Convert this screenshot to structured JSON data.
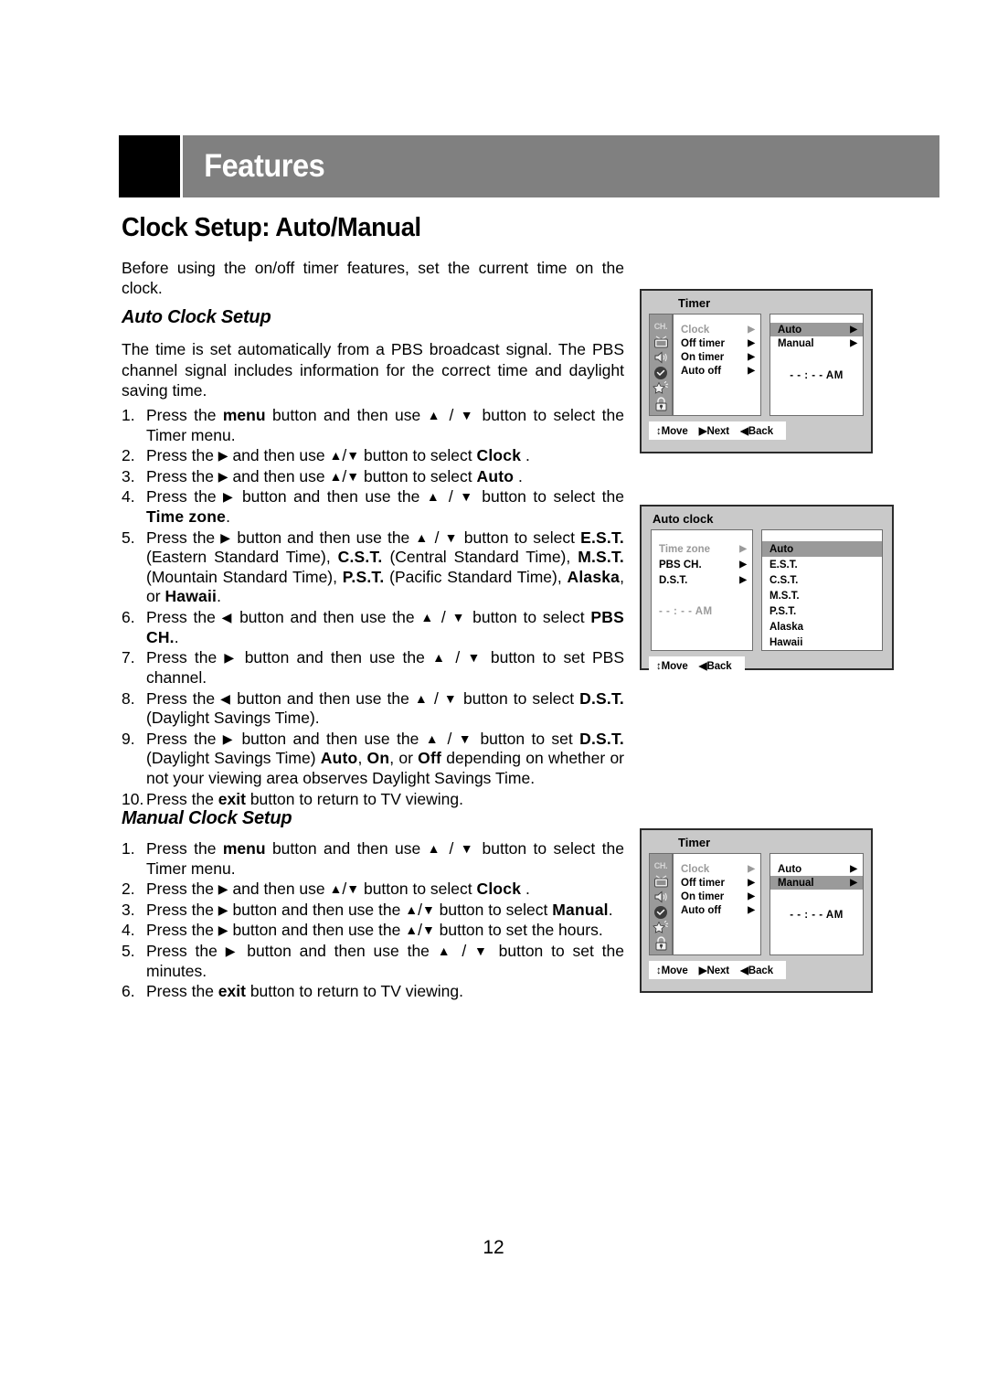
{
  "header": {
    "title": "Features"
  },
  "page": {
    "title": "Clock Setup: Auto/Manual",
    "number": "12"
  },
  "intro": "Before using the on/off timer features, set the current time on the clock.",
  "auto_section": {
    "heading": "Auto Clock Setup",
    "paragraph": "The time is set automatically from a PBS broadcast signal. The PBS channel signal includes information for the correct time and daylight saving time.",
    "steps": [
      {
        "num": "1.",
        "text": "Press the menu button and then use ▲ / ▼ button to select the Timer menu."
      },
      {
        "num": "2.",
        "text": "Press the ▶ and then use ▲/▼ button to select Clock ."
      },
      {
        "num": "3.",
        "text": "Press the ▶ and then use ▲/▼ button to select Auto ."
      },
      {
        "num": "4.",
        "text": "Press the ▶ button and then use the ▲ / ▼ button to select the Time zone."
      },
      {
        "num": "5.",
        "text": "Press the ▶ button and then use the ▲ / ▼ button to select E.S.T. (Eastern Standard Time), C.S.T. (Central Standard Time), M.S.T. (Mountain Standard Time), P.S.T. (Pacific Standard Time), Alaska, or Hawaii."
      },
      {
        "num": "6.",
        "text": "Press the ◀ button and then use the ▲ / ▼ button to select PBS CH.."
      },
      {
        "num": "7.",
        "text": "Press the ▶ button and then use the ▲ / ▼ button to set PBS channel."
      },
      {
        "num": "8.",
        "text": "Press the ◀ button and then use the ▲ / ▼ button to select D.S.T. (Daylight Savings Time)."
      },
      {
        "num": "9.",
        "text": "Press the ▶ button and then use the ▲ / ▼ button to set D.S.T. (Daylight Savings Time) Auto, On, or Off depending on whether or not your viewing area observes Daylight Savings Time."
      },
      {
        "num": "10.",
        "text": "Press the exit button to return to TV viewing."
      }
    ]
  },
  "manual_section": {
    "heading": "Manual Clock Setup",
    "steps": [
      {
        "num": "1.",
        "text": "Press the menu button and then use ▲ / ▼ button to select the Timer menu."
      },
      {
        "num": "2.",
        "text": "Press the ▶ and then use ▲/▼ button to select Clock ."
      },
      {
        "num": "3.",
        "text": "Press the ▶ button and then use the ▲/▼ button to select Manual."
      },
      {
        "num": "4.",
        "text": "Press the ▶ button and then use the ▲/▼ button to set the hours."
      },
      {
        "num": "5.",
        "text": "Press the ▶ button and then use the ▲ / ▼ button to set the minutes."
      },
      {
        "num": "6.",
        "text": "Press the exit button to return to TV viewing."
      }
    ]
  },
  "osd_timer_auto": {
    "title": "Timer",
    "icons": [
      "ch-icon",
      "tv-icon",
      "speaker-icon",
      "clock-icon",
      "star-icon",
      "lock-icon"
    ],
    "left_items": [
      {
        "label": "Clock",
        "dim": true
      },
      {
        "label": "Off timer",
        "dim": false
      },
      {
        "label": "On timer",
        "dim": false
      },
      {
        "label": "Auto off",
        "dim": false
      }
    ],
    "right_items": [
      {
        "label": "Auto",
        "selected": true
      },
      {
        "label": "Manual",
        "selected": false
      }
    ],
    "time": "- - : - - AM",
    "footer": [
      "↕Move",
      "▶Next",
      "◀Back"
    ]
  },
  "osd_auto_clock": {
    "title": "Auto clock",
    "left_items": [
      {
        "label": "Time zone",
        "dim": true,
        "arrow": true
      },
      {
        "label": "PBS CH.",
        "dim": false,
        "arrow": true
      },
      {
        "label": "D.S.T.",
        "dim": false,
        "arrow": true
      }
    ],
    "time": "- - : - - AM",
    "right_items": [
      {
        "label": "Auto",
        "selected": true
      },
      {
        "label": "E.S.T.",
        "selected": false
      },
      {
        "label": "C.S.T.",
        "selected": false
      },
      {
        "label": "M.S.T.",
        "selected": false
      },
      {
        "label": "P.S.T.",
        "selected": false
      },
      {
        "label": "Alaska",
        "selected": false
      },
      {
        "label": "Hawaii",
        "selected": false
      }
    ],
    "footer": [
      "↕Move",
      "◀Back"
    ]
  },
  "osd_timer_manual": {
    "title": "Timer",
    "left_items": [
      {
        "label": "Clock",
        "dim": true
      },
      {
        "label": "Off timer",
        "dim": false
      },
      {
        "label": "On timer",
        "dim": false
      },
      {
        "label": "Auto off",
        "dim": false
      }
    ],
    "right_items": [
      {
        "label": "Auto",
        "selected": false
      },
      {
        "label": "Manual",
        "selected": true
      }
    ],
    "time": "- - : - - AM",
    "footer": [
      "↕Move",
      "▶Next",
      "◀Back"
    ]
  },
  "colors": {
    "header_bar": "#808080",
    "header_block": "#000000",
    "osd_bg": "#c9c9c9",
    "osd_highlight": "#9a9a9a",
    "osd_dim_text": "#9a9a9a"
  }
}
